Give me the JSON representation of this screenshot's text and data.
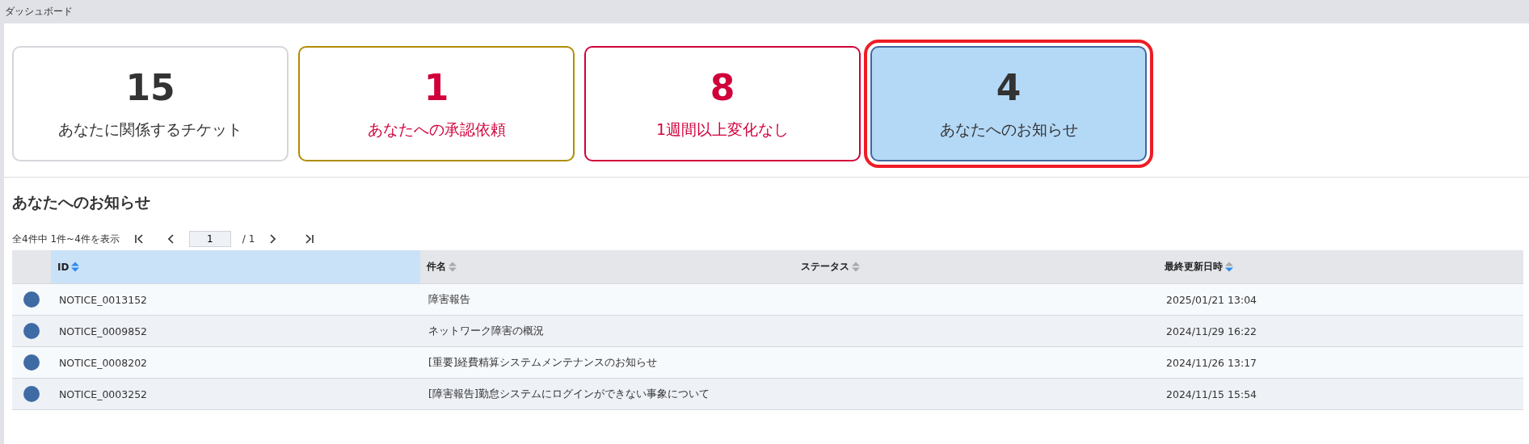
{
  "header": {
    "title": "ダッシュボード"
  },
  "cards": [
    {
      "kind": "plain",
      "count": "15",
      "label": "あなたに関係するチケット",
      "selected": false
    },
    {
      "kind": "approval",
      "count": "1",
      "label": "あなたへの承認依頼",
      "selected": false
    },
    {
      "kind": "stale",
      "count": "8",
      "label": "1週間以上変化なし",
      "selected": false
    },
    {
      "kind": "notice",
      "count": "4",
      "label": "あなたへのお知らせ",
      "selected": true
    }
  ],
  "section": {
    "title": "あなたへのお知らせ"
  },
  "pager": {
    "summary": "全4件中 1件~4件を表示",
    "page": "1",
    "total": "/ 1"
  },
  "table": {
    "columns": [
      {
        "label": "ID",
        "sort_up_active": true,
        "sort_down_active": true,
        "selected": true
      },
      {
        "label": "件名",
        "sort_up_active": false,
        "sort_down_active": false,
        "selected": false
      },
      {
        "label": "ステータス",
        "sort_up_active": false,
        "sort_down_active": false,
        "selected": false
      },
      {
        "label": "最終更新日時",
        "sort_up_active": false,
        "sort_down_active": true,
        "selected": false
      }
    ],
    "rows": [
      {
        "id": "NOTICE_0013152",
        "subject": "障害報告",
        "updated": "2025/01/21 13:04"
      },
      {
        "id": "NOTICE_0009852",
        "subject": "ネットワーク障害の概況",
        "updated": "2024/11/29 16:22"
      },
      {
        "id": "NOTICE_0008202",
        "subject": "[重要]経費精算システムメンテナンスのお知らせ",
        "updated": "2024/11/26 13:17"
      },
      {
        "id": "NOTICE_0003252",
        "subject": "[障害報告]勤怠システムにログインができない事象について",
        "updated": "2024/11/15 15:54"
      }
    ]
  }
}
